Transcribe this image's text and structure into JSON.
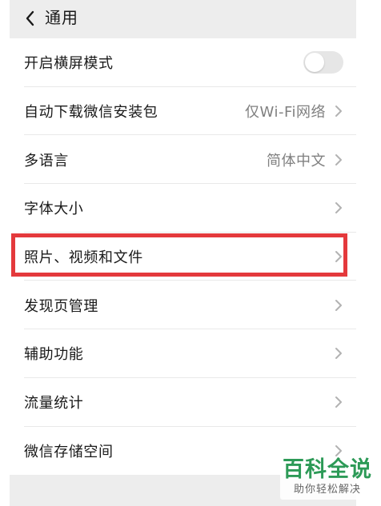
{
  "header": {
    "title": "通用"
  },
  "settings": [
    {
      "label": "开启横屏模式",
      "value": "",
      "control": "toggle",
      "enabled": false
    },
    {
      "label": "自动下载微信安装包",
      "value": "仅Wi-Fi网络",
      "control": "chevron"
    },
    {
      "label": "多语言",
      "value": "简体中文",
      "control": "chevron"
    },
    {
      "label": "字体大小",
      "value": "",
      "control": "chevron"
    },
    {
      "label": "照片、视频和文件",
      "value": "",
      "control": "chevron",
      "highlighted": true
    },
    {
      "label": "发现页管理",
      "value": "",
      "control": "chevron"
    },
    {
      "label": "辅助功能",
      "value": "",
      "control": "chevron"
    },
    {
      "label": "流量统计",
      "value": "",
      "control": "chevron"
    },
    {
      "label": "微信存储空间",
      "value": "",
      "control": "chevron"
    }
  ],
  "watermark": {
    "title": "百科全说",
    "subtitle": "助你轻松解决"
  },
  "colors": {
    "highlight": "#e4393c",
    "watermark_green": "#2d9a57"
  }
}
